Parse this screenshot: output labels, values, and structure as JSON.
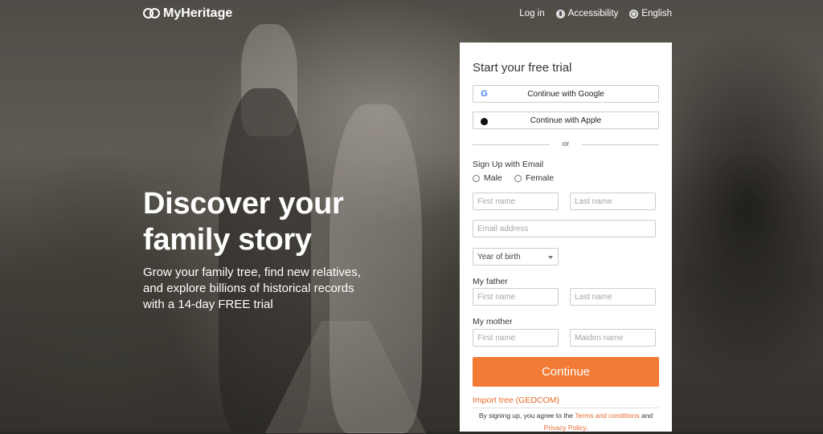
{
  "header": {
    "logo_text": "MyHeritage",
    "nav": {
      "login": "Log in",
      "accessibility": "Accessibility",
      "language": "English"
    }
  },
  "hero": {
    "title_line1": "Discover your",
    "title_line2": "family story",
    "subtitle_line1": "Grow your family tree, find new relatives,",
    "subtitle_line2": "and explore billions of historical records",
    "subtitle_line3": "with a 14-day FREE trial"
  },
  "form": {
    "title": "Start your free trial",
    "google_button": "Continue with Google",
    "apple_button": "Continue with Apple",
    "or_text": "or",
    "signup_label": "Sign Up with Email",
    "gender": {
      "male": "Male",
      "female": "Female"
    },
    "placeholders": {
      "first_name": "First name",
      "last_name": "Last name",
      "email": "Email address",
      "father_first": "First name",
      "father_last": "Last name",
      "mother_first": "First name",
      "mother_maiden": "Maiden name"
    },
    "year_of_birth": "Year of birth",
    "father_label": "My father",
    "mother_label": "My mother",
    "continue_button": "Continue",
    "import_link": "Import tree (GEDCOM)",
    "terms_prefix": "By signing up, you agree to the",
    "terms_link": "Terms and conditions",
    "terms_and": "and",
    "privacy_link": "Privacy Policy",
    "terms_suffix": "."
  },
  "colors": {
    "accent": "#f47b35",
    "link": "#e8692b",
    "google_blue": "#4285f4"
  },
  "icons": {
    "logo": "myheritage-logo-icon",
    "accessibility": "accessibility-icon",
    "language": "globe-icon",
    "google": "google-icon",
    "apple": "apple-icon",
    "select_caret": "chevron-down-icon"
  }
}
